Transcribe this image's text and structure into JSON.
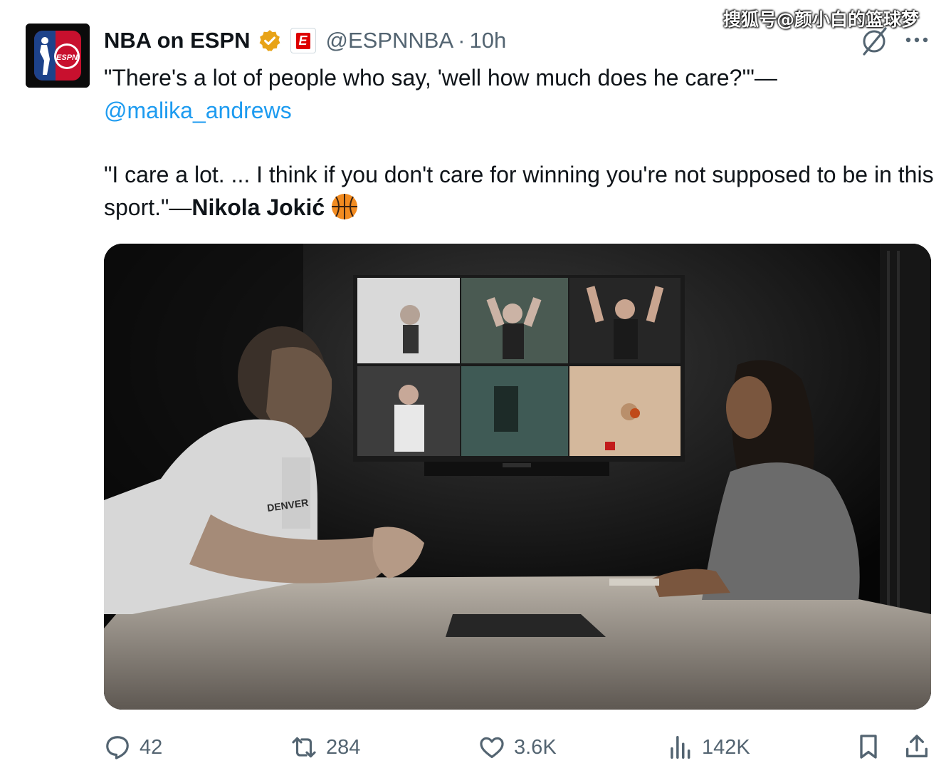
{
  "watermark": "搜狐号@颜小白的篮球梦",
  "tweet": {
    "author_name": "NBA on ESPN",
    "badge_label": "E",
    "handle": "@ESPNNBA",
    "separator": "·",
    "time": "10h",
    "line1": "\"There's a lot of people who say, 'well how much does he care?'\"—",
    "mention": "@malika_andrews",
    "line2_start": "\"I care a lot. ... I think if you don't care for winning you're not supposed to be in this sport.\"—",
    "line2_bold": "Nikola Jokić"
  },
  "avatar": {
    "logo_text": "ESPN"
  },
  "media": {
    "jersey_text": "DENVER"
  },
  "actions": {
    "replies": "42",
    "reposts": "284",
    "likes": "3.6K",
    "views": "142K"
  },
  "icons": [
    "grok-icon",
    "more-icon",
    "reply-icon",
    "repost-icon",
    "like-icon",
    "views-icon",
    "bookmark-icon",
    "share-icon",
    "verified-icon",
    "basketball-icon"
  ],
  "colors": {
    "accent": "#1d9bf0",
    "text": "#0f1419",
    "muted": "#536471",
    "verified": "#e8a317",
    "espn_red": "#dd0000"
  }
}
